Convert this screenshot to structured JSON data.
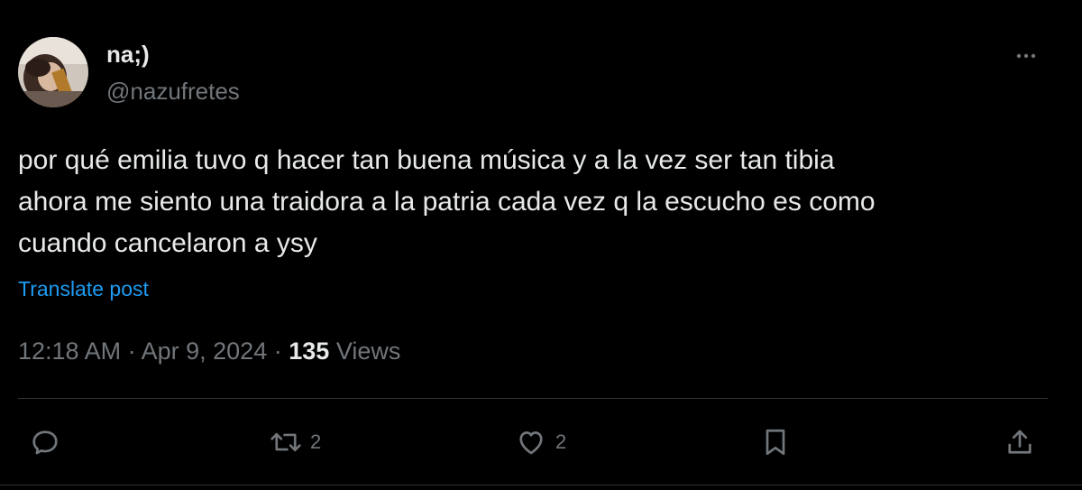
{
  "author": {
    "display_name": "na;)",
    "handle": "@nazufretes"
  },
  "tweet": {
    "text_lines": [
      "por qué emilia tuvo q hacer tan buena música y a la vez ser tan tibia",
      "ahora me siento una traidora a la patria cada vez q la escucho es como",
      "cuando cancelaron a ysy"
    ],
    "translate_label": "Translate post",
    "time": "12:18 AM",
    "separator": "·",
    "date": "Apr 9, 2024",
    "views_count": "135",
    "views_label": "Views"
  },
  "actions": {
    "reply": {
      "icon": "reply-icon",
      "count": ""
    },
    "repost": {
      "icon": "repost-icon",
      "count": "2"
    },
    "like": {
      "icon": "heart-icon",
      "count": "2"
    },
    "bookmark": {
      "icon": "bookmark-icon",
      "count": ""
    },
    "share": {
      "icon": "share-icon",
      "count": ""
    }
  },
  "colors": {
    "background": "#000000",
    "text_primary": "#e7e9ea",
    "text_secondary": "#71767b",
    "link": "#1d9bf0",
    "divider": "#2f3336"
  }
}
